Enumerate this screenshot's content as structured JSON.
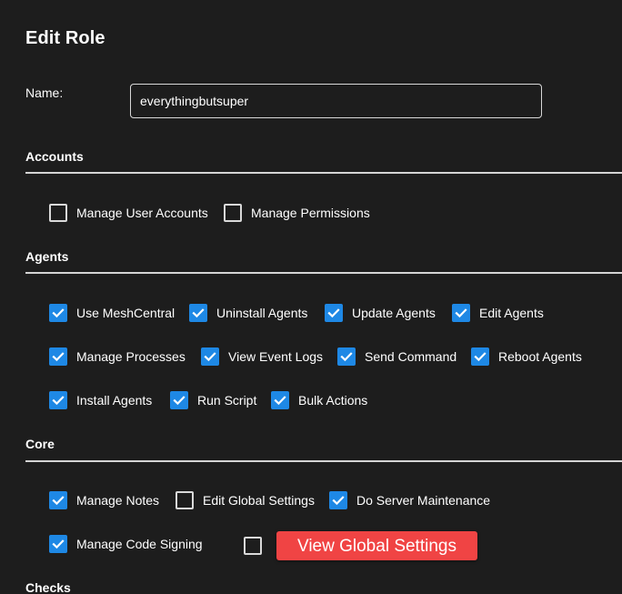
{
  "dialog": {
    "title": "Edit Role"
  },
  "name_field": {
    "label": "Name:",
    "value": "everythingbutsuper"
  },
  "sections": {
    "accounts": {
      "title": "Accounts",
      "options": [
        {
          "label": "Manage User Accounts",
          "checked": false
        },
        {
          "label": "Manage Permissions",
          "checked": false
        }
      ]
    },
    "agents": {
      "title": "Agents",
      "options": [
        {
          "label": "Use MeshCentral",
          "checked": true
        },
        {
          "label": "Uninstall Agents",
          "checked": true
        },
        {
          "label": "Update Agents",
          "checked": true
        },
        {
          "label": "Edit Agents",
          "checked": true
        },
        {
          "label": "Manage Processes",
          "checked": true
        },
        {
          "label": "View Event Logs",
          "checked": true
        },
        {
          "label": "Send Command",
          "checked": true
        },
        {
          "label": "Reboot Agents",
          "checked": true
        },
        {
          "label": "Install Agents",
          "checked": true
        },
        {
          "label": "Run Script",
          "checked": true
        },
        {
          "label": "Bulk Actions",
          "checked": true
        }
      ]
    },
    "core": {
      "title": "Core",
      "options": [
        {
          "label": "Manage Notes",
          "checked": true
        },
        {
          "label": "Edit Global Settings",
          "checked": false
        },
        {
          "label": "Do Server Maintenance",
          "checked": true
        },
        {
          "label": "Manage Code Signing",
          "checked": true
        },
        {
          "label": "",
          "checked": false
        }
      ],
      "view_global_settings_button": "View Global Settings"
    },
    "checks": {
      "title": "Checks"
    }
  },
  "colors": {
    "background": "#1d1d1d",
    "checkbox_checked": "#1e88e5",
    "danger_button": "#f04444"
  }
}
